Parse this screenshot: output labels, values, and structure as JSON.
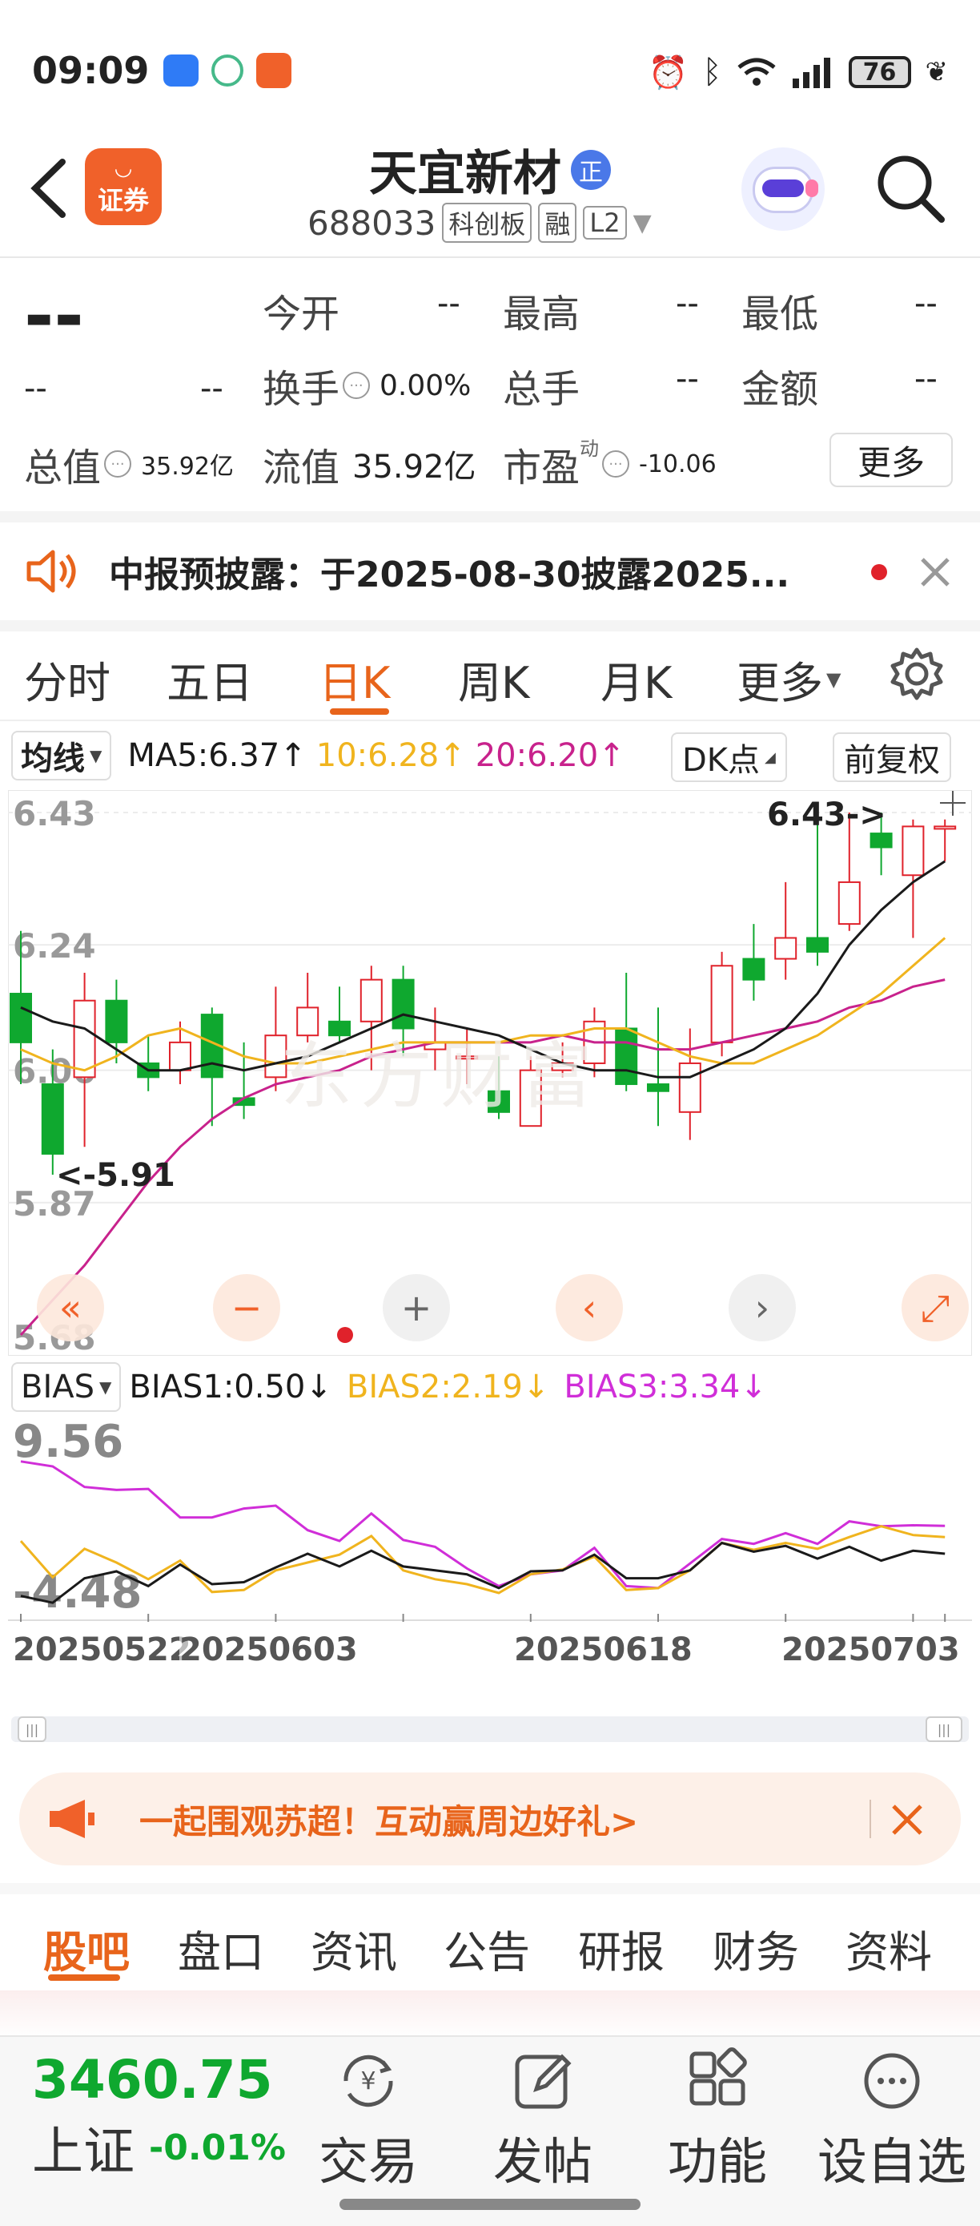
{
  "status_bar": {
    "time": "09:09",
    "battery": "76"
  },
  "header": {
    "title": "天宜新材",
    "badge": "正",
    "code": "688033",
    "tag_kcb": "科创板",
    "tag_rong": "融",
    "tag_l2": "L2",
    "logo_text": "证券"
  },
  "quote": {
    "price": "--",
    "change": "--",
    "change_pct": "--",
    "open_label": "今开",
    "open_value": "--",
    "high_label": "最高",
    "high_value": "--",
    "low_label": "最低",
    "low_value": "--",
    "turnover_label": "换手",
    "turnover_value": "0.00%",
    "volume_label": "总手",
    "volume_value": "--",
    "amount_label": "金额",
    "amount_value": "--",
    "mktcap_label": "总值",
    "mktcap_value": "35.92亿",
    "float_label": "流值",
    "float_value": "35.92亿",
    "pe_label": "市盈",
    "pe_sup": "动",
    "pe_value": "-10.06",
    "more_button": "更多"
  },
  "notice": {
    "text": "中报预披露：于2025-08-30披露2025..."
  },
  "tabs": {
    "items": [
      "分时",
      "五日",
      "日K",
      "周K",
      "月K",
      "更多"
    ],
    "active": 2
  },
  "indicator_bar": {
    "selector": "均线",
    "ma5": "MA5:6.37",
    "ma10": "10:6.28",
    "ma20": "20:6.20",
    "dk": "DK点",
    "fq": "前复权"
  },
  "kline": {
    "y_labels": [
      "6.43",
      "6.24",
      "6.06",
      "5.87",
      "5.68"
    ],
    "max_annotation": "6.43->",
    "min_annotation": "<-5.91",
    "watermark": "东方财富",
    "candles": [
      {
        "o": 6.17,
        "c": 6.1,
        "h": 6.26,
        "l": 6.04
      },
      {
        "o": 6.04,
        "c": 5.94,
        "h": 6.09,
        "l": 5.91
      },
      {
        "o": 6.05,
        "c": 6.16,
        "h": 6.2,
        "l": 5.95
      },
      {
        "o": 6.16,
        "c": 6.1,
        "h": 6.19,
        "l": 6.07
      },
      {
        "o": 6.07,
        "c": 6.05,
        "h": 6.11,
        "l": 6.03
      },
      {
        "o": 6.06,
        "c": 6.1,
        "h": 6.13,
        "l": 6.04
      },
      {
        "o": 6.14,
        "c": 6.05,
        "h": 6.15,
        "l": 5.98
      },
      {
        "o": 6.02,
        "c": 6.01,
        "h": 6.1,
        "l": 5.99
      },
      {
        "o": 6.05,
        "c": 6.11,
        "h": 6.18,
        "l": 6.03
      },
      {
        "o": 6.11,
        "c": 6.15,
        "h": 6.2,
        "l": 6.1
      },
      {
        "o": 6.13,
        "c": 6.11,
        "h": 6.18,
        "l": 6.1
      },
      {
        "o": 6.13,
        "c": 6.19,
        "h": 6.21,
        "l": 6.06
      },
      {
        "o": 6.19,
        "c": 6.12,
        "h": 6.21,
        "l": 6.08
      },
      {
        "o": 6.09,
        "c": 6.1,
        "h": 6.15,
        "l": 6.06
      },
      {
        "o": 6.08,
        "c": 6.08,
        "h": 6.12,
        "l": 6.04
      },
      {
        "o": 6.03,
        "c": 6.0,
        "h": 6.08,
        "l": 5.99
      },
      {
        "o": 5.98,
        "c": 6.06,
        "h": 6.08,
        "l": 5.98
      },
      {
        "o": 6.06,
        "c": 6.07,
        "h": 6.1,
        "l": 6.05
      },
      {
        "o": 6.07,
        "c": 6.13,
        "h": 6.15,
        "l": 6.05
      },
      {
        "o": 6.12,
        "c": 6.04,
        "h": 6.2,
        "l": 6.03
      },
      {
        "o": 6.04,
        "c": 6.03,
        "h": 6.15,
        "l": 5.98
      },
      {
        "o": 6.0,
        "c": 6.07,
        "h": 6.12,
        "l": 5.96
      },
      {
        "o": 6.1,
        "c": 6.21,
        "h": 6.23,
        "l": 6.08
      },
      {
        "o": 6.22,
        "c": 6.19,
        "h": 6.27,
        "l": 6.16
      },
      {
        "o": 6.22,
        "c": 6.25,
        "h": 6.33,
        "l": 6.19
      },
      {
        "o": 6.25,
        "c": 6.23,
        "h": 6.43,
        "l": 6.21
      },
      {
        "o": 6.27,
        "c": 6.33,
        "h": 6.43,
        "l": 6.26
      },
      {
        "o": 6.4,
        "c": 6.38,
        "h": 6.43,
        "l": 6.34
      },
      {
        "o": 6.34,
        "c": 6.41,
        "h": 6.42,
        "l": 6.25
      },
      {
        "o": 6.41,
        "c": 6.41,
        "h": 6.42,
        "l": 6.36
      }
    ],
    "ma5": [
      6.15,
      6.13,
      6.12,
      6.09,
      6.06,
      6.06,
      6.07,
      6.06,
      6.07,
      6.08,
      6.1,
      6.12,
      6.14,
      6.13,
      6.12,
      6.11,
      6.09,
      6.07,
      6.06,
      6.06,
      6.05,
      6.05,
      6.07,
      6.09,
      6.12,
      6.17,
      6.24,
      6.29,
      6.33,
      6.36
    ],
    "ma10": [
      6.09,
      6.07,
      6.06,
      6.08,
      6.11,
      6.12,
      6.1,
      6.08,
      6.07,
      6.07,
      6.08,
      6.09,
      6.1,
      6.1,
      6.1,
      6.1,
      6.11,
      6.11,
      6.12,
      6.12,
      6.1,
      6.08,
      6.07,
      6.07,
      6.09,
      6.11,
      6.14,
      6.17,
      6.21,
      6.25
    ],
    "ma20": [
      5.68,
      5.73,
      5.78,
      5.84,
      5.9,
      5.95,
      5.99,
      6.02,
      6.04,
      6.05,
      6.06,
      6.08,
      6.09,
      6.1,
      6.1,
      6.1,
      6.1,
      6.11,
      6.1,
      6.1,
      6.09,
      6.09,
      6.1,
      6.11,
      6.12,
      6.13,
      6.15,
      6.16,
      6.18,
      6.19
    ],
    "controls": [
      "double-left",
      "minus",
      "plus",
      "left",
      "right",
      "expand"
    ]
  },
  "bias": {
    "selector": "BIAS",
    "bias1": "BIAS1:0.50",
    "bias2": "BIAS2:2.19",
    "bias3": "BIAS3:3.34",
    "y_labels": [
      "9.56",
      "-4.48"
    ],
    "bias1_values": [
      -3.8,
      -4.5,
      -2.0,
      -1.3,
      -2.8,
      -0.6,
      -2.6,
      -2.4,
      -0.9,
      0.5,
      -0.8,
      0.8,
      -0.8,
      -1.2,
      -1.6,
      -3.0,
      -1.3,
      -1.2,
      0.4,
      -2.0,
      -2.0,
      -1.2,
      1.6,
      0.7,
      1.3,
      0.0,
      1.2,
      -0.2,
      0.8,
      0.5
    ],
    "bias2_values": [
      1.8,
      -1.9,
      1.0,
      -0.4,
      -2.1,
      -0.2,
      -3.4,
      -3.2,
      -1.2,
      -0.4,
      0.4,
      2.3,
      -1.2,
      -2.1,
      -2.6,
      -3.5,
      -1.6,
      -1.1,
      0.2,
      -3.2,
      -3.0,
      -1.2,
      1.6,
      0.9,
      1.6,
      1.0,
      2.2,
      3.3,
      2.4,
      2.19
    ],
    "bias3_values": [
      9.9,
      9.4,
      7.3,
      7.0,
      7.1,
      4.2,
      4.2,
      5.1,
      5.4,
      2.9,
      1.8,
      4.6,
      1.9,
      1.2,
      -1.0,
      -2.8,
      -1.6,
      -1.2,
      1.1,
      -2.8,
      -3.0,
      -0.5,
      2.0,
      1.5,
      2.6,
      1.5,
      3.8,
      3.3,
      3.4,
      3.34
    ],
    "dates": [
      "20250522",
      "20250603",
      "20250618",
      "20250703"
    ]
  },
  "promo": {
    "text": "一起围观苏超！互动赢周边好礼>"
  },
  "subtabs": {
    "items": [
      "股吧",
      "盘口",
      "资讯",
      "公告",
      "研报",
      "财务",
      "资料"
    ],
    "active": 0
  },
  "bottom_nav": {
    "index_value": "3460.75",
    "index_name": "上证",
    "index_change": "-0.01%",
    "items": [
      {
        "label": "交易",
        "icon": "yen-exchange-icon"
      },
      {
        "label": "发帖",
        "icon": "edit-icon"
      },
      {
        "label": "功能",
        "icon": "grid-icon"
      },
      {
        "label": "设自选",
        "icon": "more-icon"
      }
    ]
  },
  "colors": {
    "up": "#e0222b",
    "down": "#0fa82f",
    "accent": "#e8641b",
    "ma5": "#1a1a1a",
    "ma10": "#f0b41e",
    "ma20": "#c8228c",
    "bias3": "#d02ed8"
  }
}
